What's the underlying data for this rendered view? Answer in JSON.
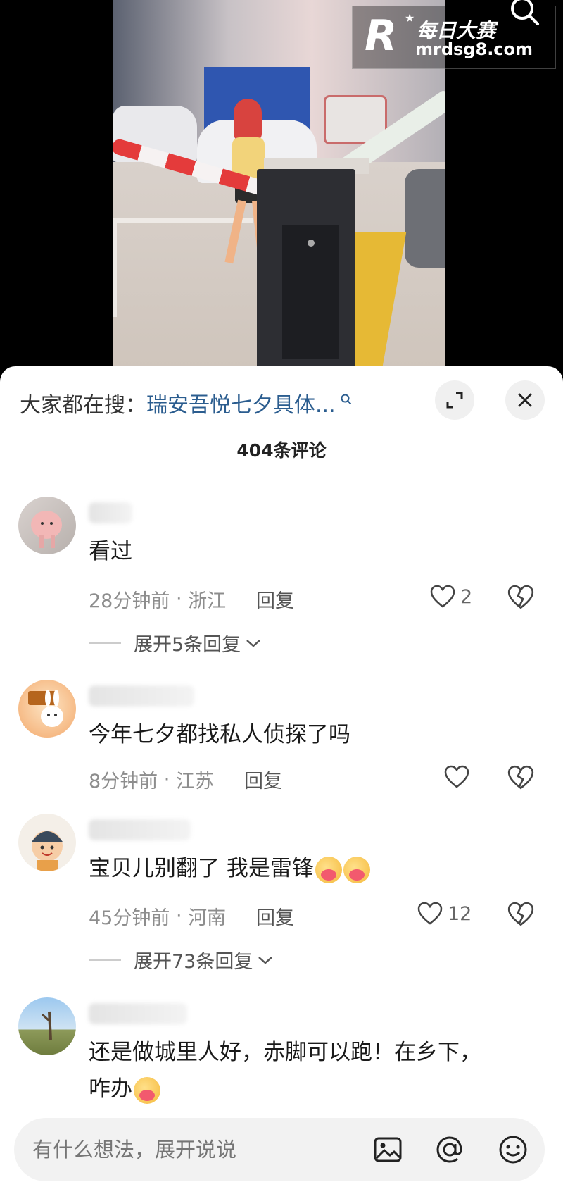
{
  "watermark": {
    "logo_letter": "R",
    "title": "每日大赛",
    "url": "mrdsg8.com"
  },
  "icons": {
    "top_search": "search-icon",
    "expand": "expand-icon",
    "close": "close-icon",
    "like": "heart-icon",
    "dislike": "broken-heart-icon",
    "image": "image-icon",
    "mention": "at-icon",
    "emoji": "smiley-icon"
  },
  "sheet": {
    "hot_search_prefix": "大家都在搜：",
    "hot_search_query": "瑞安吾悦七夕具体...",
    "comment_count": "404条评论"
  },
  "comments": [
    {
      "text": "看过",
      "time": "28分钟前",
      "region": "浙江",
      "reply_label": "回复",
      "likes": "2",
      "expand_label": "展开5条回复"
    },
    {
      "text": "今年七夕都找私人侦探了吗",
      "time": "8分钟前",
      "region": "江苏",
      "reply_label": "回复",
      "likes": "",
      "expand_label": ""
    },
    {
      "text": "宝贝儿别翻了 我是雷锋",
      "time": "45分钟前",
      "region": "河南",
      "reply_label": "回复",
      "likes": "12",
      "expand_label": "展开73条回复"
    },
    {
      "text_line1": "还是做城里人好，赤脚可以跑！在乡下，",
      "text_line2": "咋办"
    }
  ],
  "input": {
    "placeholder": "有什么想法，展开说说"
  },
  "meta_separator": " · ",
  "colors": {
    "link": "#2b5d8f",
    "muted": "#8d8d8d",
    "sheet_bg": "#ffffff",
    "input_bg": "#f2f2f2"
  }
}
